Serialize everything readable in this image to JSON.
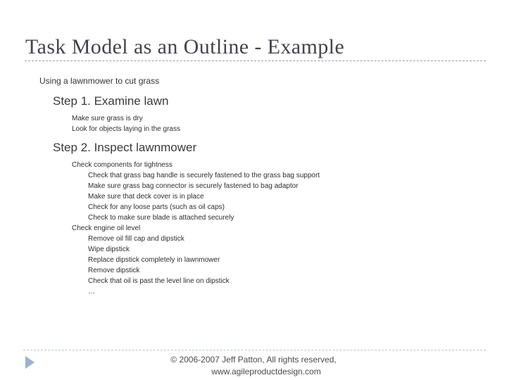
{
  "slide": {
    "title": "Task Model as an Outline - Example",
    "outline": [
      {
        "level": 1,
        "text": "Using a lawnmower to cut grass"
      },
      {
        "level": 2,
        "text": "Step 1. Examine lawn"
      },
      {
        "level": 3,
        "text": "Make sure grass is dry"
      },
      {
        "level": 3,
        "text": "Look for objects laying in the grass"
      },
      {
        "level": 2,
        "text": "Step 2. Inspect lawnmower"
      },
      {
        "level": 3,
        "text": "Check components for tightness"
      },
      {
        "level": 4,
        "text": "Check that grass bag handle is securely fastened to the grass bag support"
      },
      {
        "level": 4,
        "text": "Make sure grass bag connector is securely fastened to bag adaptor"
      },
      {
        "level": 4,
        "text": "Make sure that deck cover is in place"
      },
      {
        "level": 4,
        "text": "Check for any loose parts (such as oil caps)"
      },
      {
        "level": 4,
        "text": "Check to make sure blade is attached securely"
      },
      {
        "level": 3,
        "text": "Check engine oil level"
      },
      {
        "level": 4,
        "text": "Remove oil fill cap and dipstick"
      },
      {
        "level": 4,
        "text": "Wipe dipstick"
      },
      {
        "level": 4,
        "text": "Replace dipstick completely in lawnmower"
      },
      {
        "level": 4,
        "text": "Remove dipstick"
      },
      {
        "level": 4,
        "text": "Check that oil is past the level line on dipstick"
      },
      {
        "level": 4,
        "text": "…"
      }
    ],
    "footer": {
      "copyright": "© 2006-2007 Jeff Patton, All rights reserved,",
      "website": "www.agileproductdesign.com"
    },
    "navigation": {
      "next_icon": "play-triangle-icon"
    },
    "colors": {
      "title": "#434350",
      "body_text": "#2e2e2e",
      "rule_top": "#9c9c9c",
      "rule_bottom": "#b9c4d4",
      "nav_triangle": "#9db3cc",
      "background": "#ffffff"
    }
  }
}
